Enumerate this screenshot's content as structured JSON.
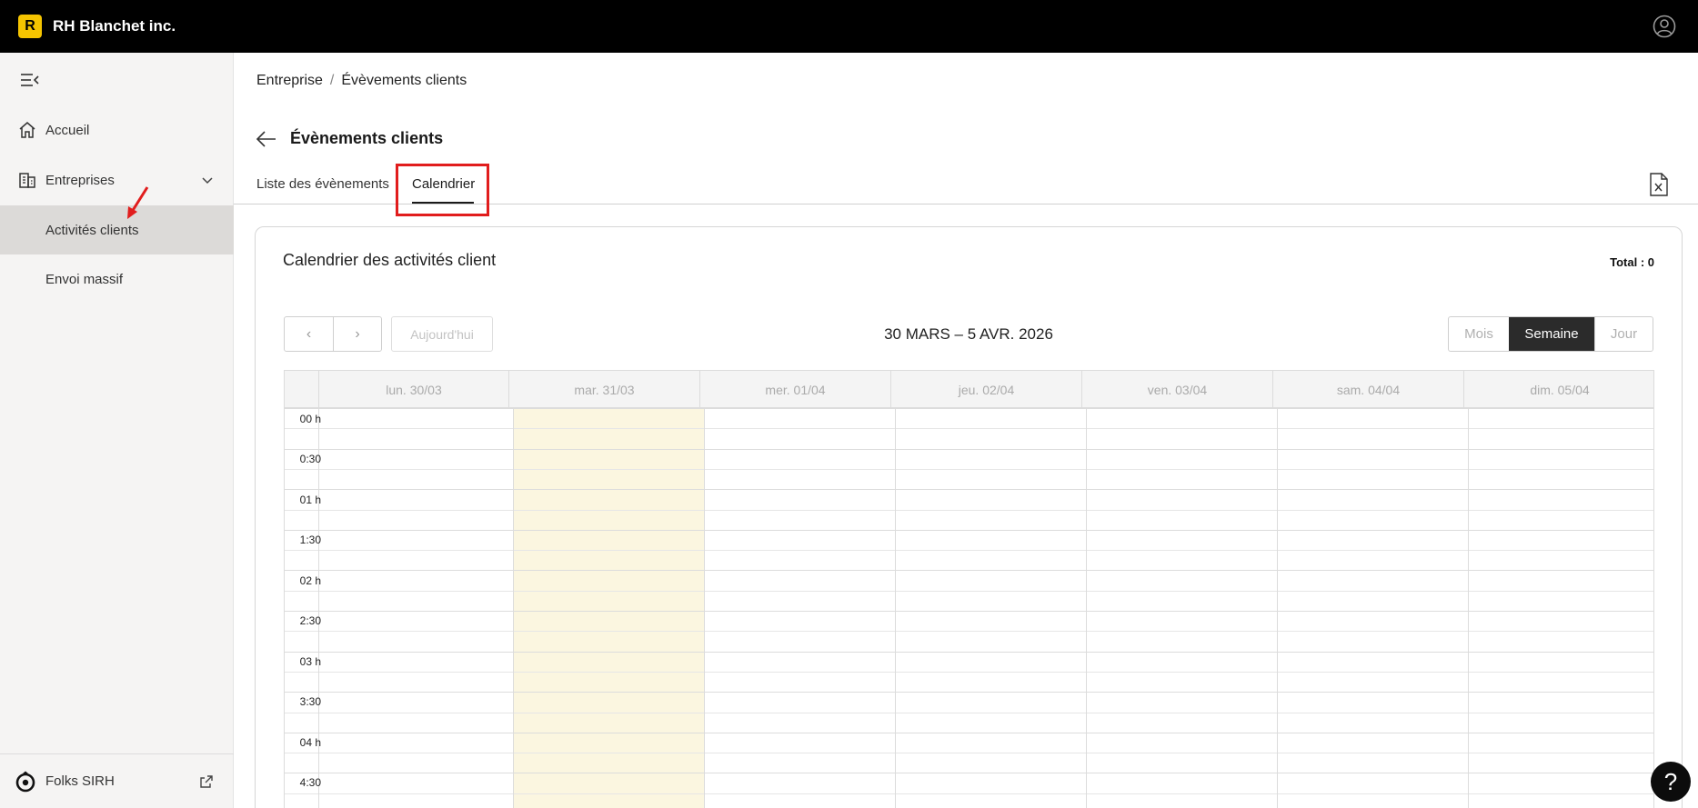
{
  "topbar": {
    "logo_letter": "R",
    "company": "RH Blanchet inc."
  },
  "sidebar": {
    "items": [
      {
        "label": "Accueil"
      },
      {
        "label": "Entreprises"
      },
      {
        "label": "Activités clients"
      },
      {
        "label": "Envoi massif"
      }
    ],
    "footer": {
      "label": "Folks SIRH"
    }
  },
  "breadcrumb": {
    "root": "Entreprise",
    "separator": "/",
    "current": "Évèvements clients"
  },
  "page": {
    "title": "Évènements clients"
  },
  "tabs": [
    {
      "label": "Liste des évènements"
    },
    {
      "label": "Calendrier"
    }
  ],
  "card": {
    "title": "Calendrier des activités client",
    "total": "Total : 0"
  },
  "toolbar": {
    "prev": "‹",
    "next": "›",
    "today": "Aujourd'hui",
    "range": "30 MARS – 5 AVR. 2026",
    "views": {
      "month": "Mois",
      "week": "Semaine",
      "day": "Jour"
    }
  },
  "calendar": {
    "days": [
      "lun. 30/03",
      "mar. 31/03",
      "mer. 01/04",
      "jeu. 02/04",
      "ven. 03/04",
      "sam. 04/04",
      "dim. 05/04"
    ],
    "today_index": 1,
    "times": [
      "00 h",
      "0:30",
      "01 h",
      "1:30",
      "02 h",
      "2:30",
      "03 h",
      "3:30",
      "04 h",
      "4:30"
    ]
  },
  "help": {
    "label": "?"
  }
}
